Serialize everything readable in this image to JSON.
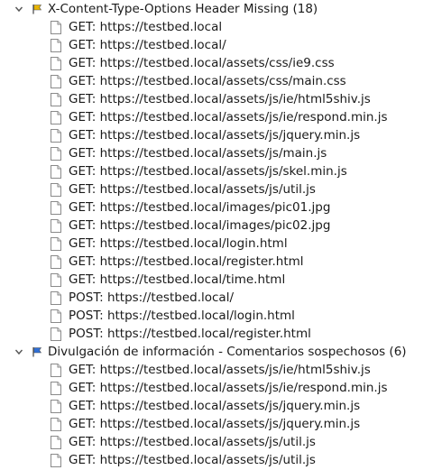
{
  "alerts": [
    {
      "title": "X-Content-Type-Options Header Missing (18)",
      "flag_color": "#e8b400",
      "flag_name": "flag-yellow-icon",
      "items": [
        "GET: https://testbed.local",
        "GET: https://testbed.local/",
        "GET: https://testbed.local/assets/css/ie9.css",
        "GET: https://testbed.local/assets/css/main.css",
        "GET: https://testbed.local/assets/js/ie/html5shiv.js",
        "GET: https://testbed.local/assets/js/ie/respond.min.js",
        "GET: https://testbed.local/assets/js/jquery.min.js",
        "GET: https://testbed.local/assets/js/main.js",
        "GET: https://testbed.local/assets/js/skel.min.js",
        "GET: https://testbed.local/assets/js/util.js",
        "GET: https://testbed.local/images/pic01.jpg",
        "GET: https://testbed.local/images/pic02.jpg",
        "GET: https://testbed.local/login.html",
        "GET: https://testbed.local/register.html",
        "GET: https://testbed.local/time.html",
        "POST: https://testbed.local/",
        "POST: https://testbed.local/login.html",
        "POST: https://testbed.local/register.html"
      ]
    },
    {
      "title": "Divulgación de información - Comentarios sospechosos (6)",
      "flag_color": "#2f6fd6",
      "flag_name": "flag-blue-icon",
      "items": [
        "GET: https://testbed.local/assets/js/ie/html5shiv.js",
        "GET: https://testbed.local/assets/js/ie/respond.min.js",
        "GET: https://testbed.local/assets/js/jquery.min.js",
        "GET: https://testbed.local/assets/js/jquery.min.js",
        "GET: https://testbed.local/assets/js/util.js",
        "GET: https://testbed.local/assets/js/util.js"
      ]
    }
  ]
}
